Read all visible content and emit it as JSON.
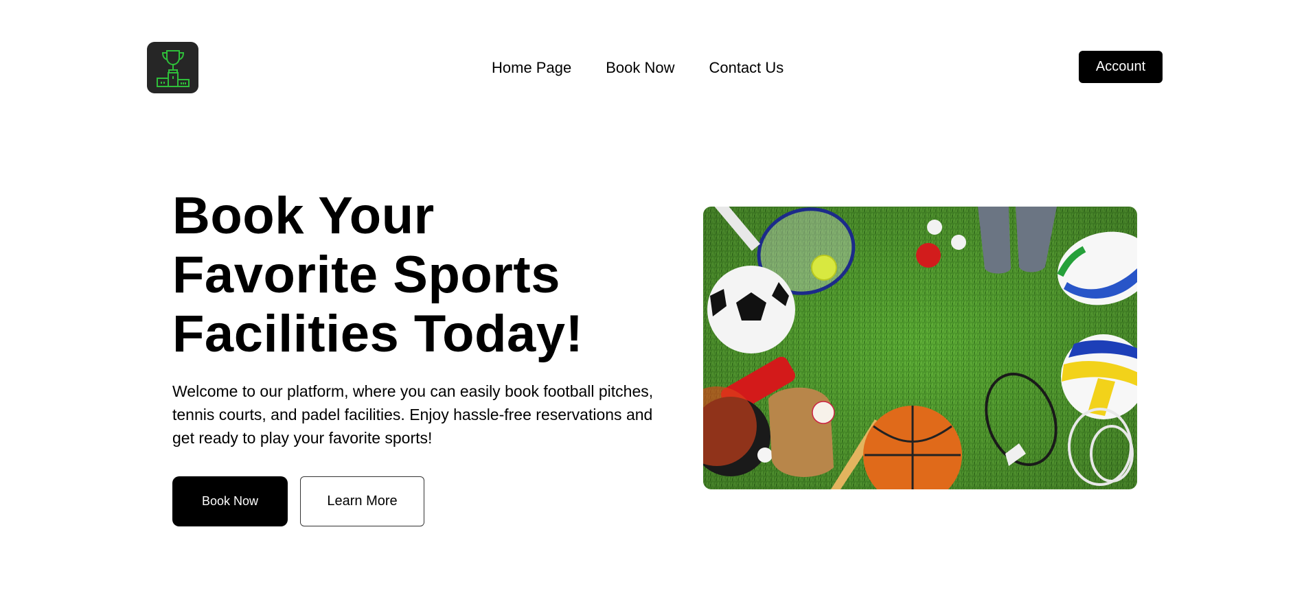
{
  "header": {
    "logo_icon": "trophy-podium-icon",
    "nav": [
      {
        "label": "Home Page"
      },
      {
        "label": "Book Now"
      },
      {
        "label": "Contact Us"
      }
    ],
    "account_label": "Account"
  },
  "hero": {
    "title": "Book Your Favorite Sports Facilities Today!",
    "description": "Welcome to our platform, where you can easily book football pitches, tennis courts, and padel facilities. Enjoy hassle-free reservations and get ready to play your favorite sports!",
    "primary_button": "Book Now",
    "secondary_button": "Learn More",
    "image": "sports-equipment-on-grass-photo"
  },
  "colors": {
    "accent": "#000000",
    "logo_bg": "#262626",
    "logo_green": "#2fbf3a",
    "grass": "#4e9a2c"
  }
}
